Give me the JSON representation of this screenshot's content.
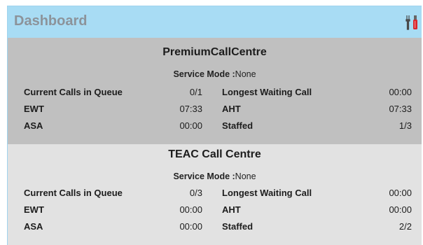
{
  "header": {
    "title": "Dashboard",
    "tools_icon": "tools-icon"
  },
  "centres": [
    {
      "name": "PremiumCallCentre",
      "service_mode_label": "Service Mode :",
      "service_mode_value": "None",
      "rows": [
        {
          "label_left": "Current Calls in Queue",
          "value_left": "0/1",
          "label_right": "Longest Waiting Call",
          "value_right": "00:00"
        },
        {
          "label_left": "EWT",
          "value_left": "07:33",
          "label_right": "AHT",
          "value_right": "07:33"
        },
        {
          "label_left": "ASA",
          "value_left": "00:00",
          "label_right": "Staffed",
          "value_right": "1/3"
        }
      ]
    },
    {
      "name": "TEAC Call Centre",
      "service_mode_label": "Service Mode :",
      "service_mode_value": "None",
      "rows": [
        {
          "label_left": "Current Calls in Queue",
          "value_left": "0/3",
          "label_right": "Longest Waiting Call",
          "value_right": "00:00"
        },
        {
          "label_left": "EWT",
          "value_left": "00:00",
          "label_right": "AHT",
          "value_right": "00:00"
        },
        {
          "label_left": "ASA",
          "value_left": "00:00",
          "label_right": "Staffed",
          "value_right": "2/2"
        }
      ]
    }
  ],
  "colors": {
    "header_bg": "#a8dcf4",
    "header_text": "#8c939a",
    "centre1_bg": "#c0c0c0",
    "centre2_bg": "#e2e2e2",
    "icon_red": "#d9262c"
  }
}
